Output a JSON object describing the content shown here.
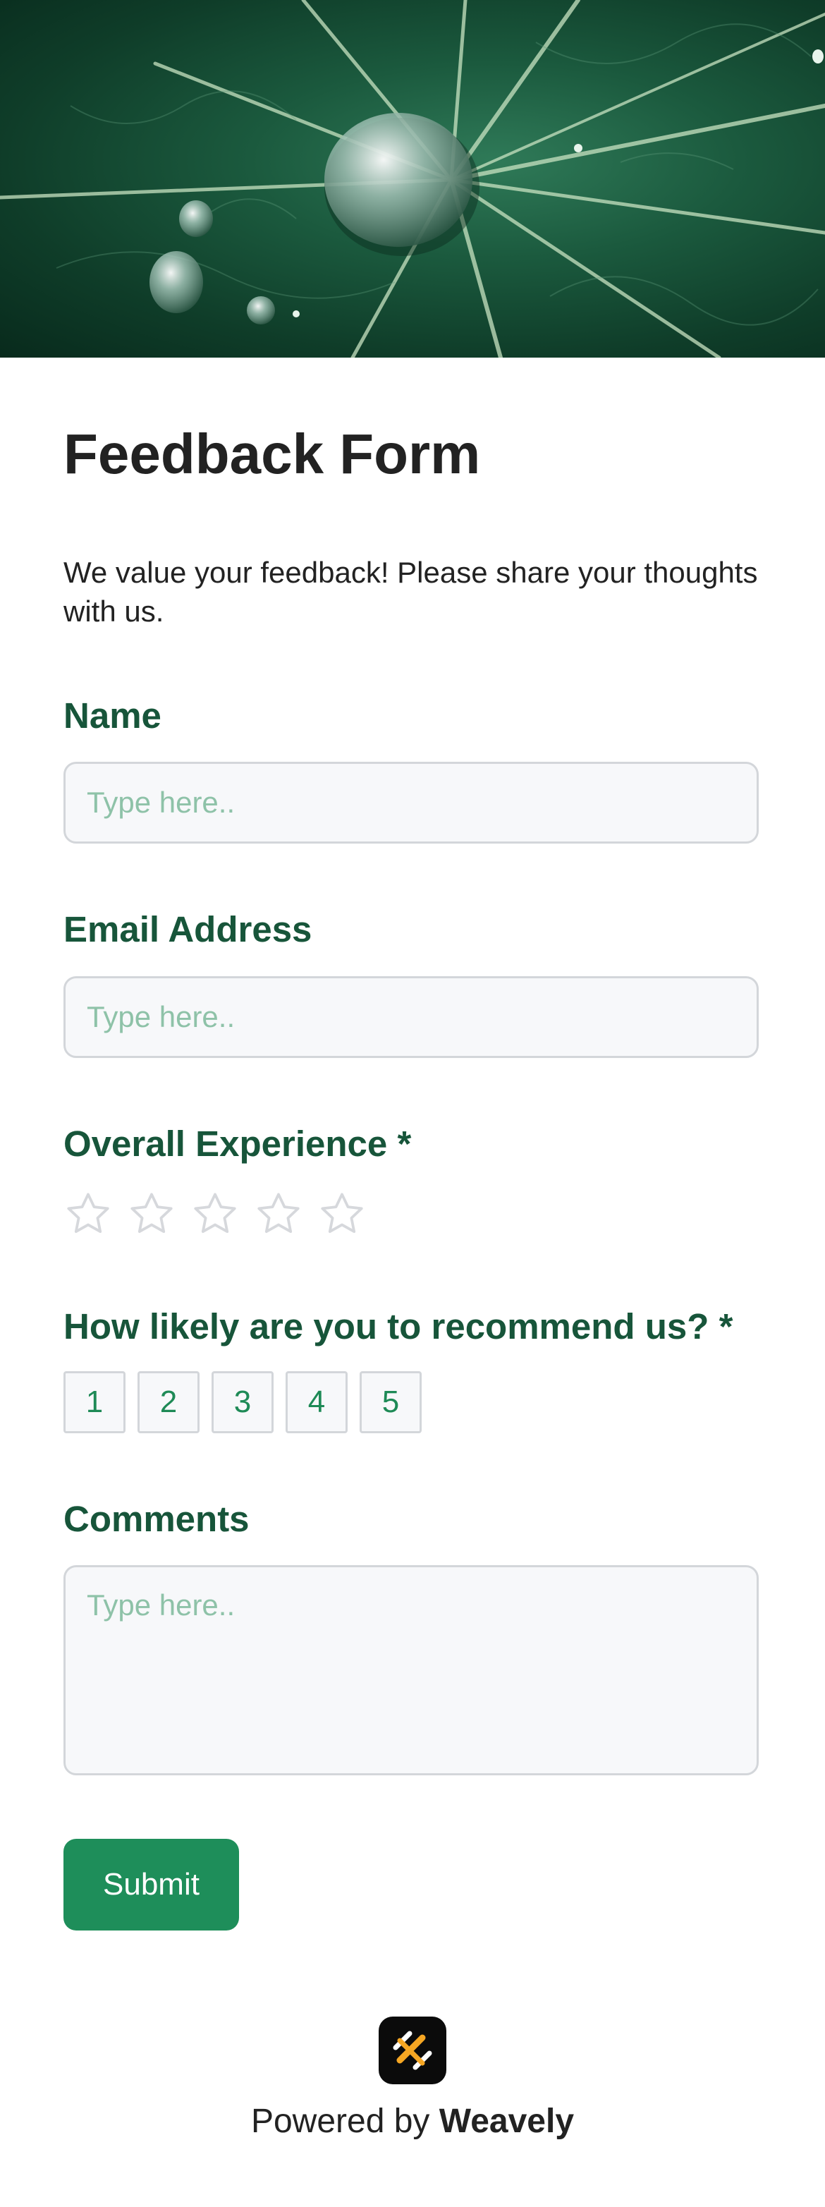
{
  "form": {
    "title": "Feedback Form",
    "description": "We value your feedback! Please share your thoughts with us.",
    "fields": {
      "name": {
        "label": "Name",
        "placeholder": "Type here.."
      },
      "email": {
        "label": "Email Address",
        "placeholder": "Type here.."
      },
      "experience": {
        "label": "Overall Experience *",
        "max_stars": 5,
        "selected_stars": 0
      },
      "recommend": {
        "label": "How likely are you to recommend us? *",
        "options": [
          "1",
          "2",
          "3",
          "4",
          "5"
        ]
      },
      "comments": {
        "label": "Comments",
        "placeholder": "Type here.."
      }
    },
    "submit_label": "Submit"
  },
  "footer": {
    "powered_prefix": "Powered by",
    "brand": "Weavely",
    "logo_icon": "weavely-logo-icon"
  },
  "colors": {
    "accent": "#1e8e5a",
    "label": "#17553a",
    "placeholder": "#8ec2a8"
  }
}
